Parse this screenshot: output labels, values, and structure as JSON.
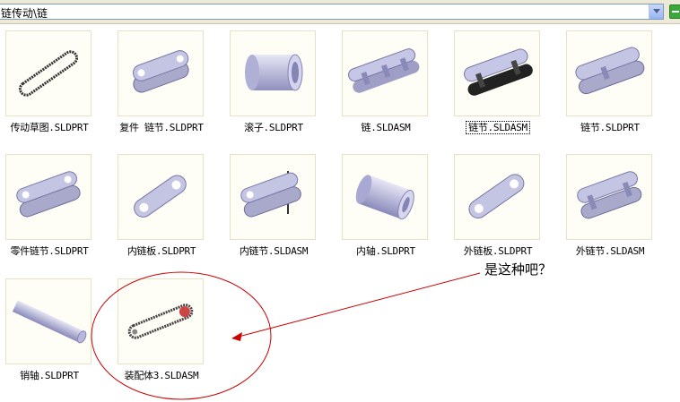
{
  "address_bar": {
    "path": "链传动\\链",
    "go_color": "#3aa83a"
  },
  "files": [
    {
      "name": "传动草图.SLDPRT",
      "icon": "sketch-chain-loop-icon"
    },
    {
      "name": "复件 链节.SLDPRT",
      "icon": "chain-link-icon"
    },
    {
      "name": "滚子.SLDPRT",
      "icon": "roller-cylinder-icon"
    },
    {
      "name": "链.SLDASM",
      "icon": "chain-assembly-icon"
    },
    {
      "name": "链节.SLDASM",
      "icon": "chain-link-assembly-icon",
      "selected": true
    },
    {
      "name": "链节.SLDPRT",
      "icon": "chain-link-icon"
    },
    {
      "name": "零件链节.SLDPRT",
      "icon": "chain-link-icon"
    },
    {
      "name": "内链板.SLDPRT",
      "icon": "inner-plate-icon"
    },
    {
      "name": "内链节.SLDASM",
      "icon": "inner-link-assembly-icon"
    },
    {
      "name": "内轴.SLDPRT",
      "icon": "bushing-cylinder-icon"
    },
    {
      "name": "外链板.SLDPRT",
      "icon": "outer-plate-icon"
    },
    {
      "name": "外链节.SLDASM",
      "icon": "outer-link-assembly-icon"
    },
    {
      "name": "销轴.SLDPRT",
      "icon": "pin-shaft-icon"
    },
    {
      "name": "装配体3.SLDASM",
      "icon": "chain-drive-assembly-icon"
    }
  ],
  "annotation": {
    "text": "是这种吧？",
    "color": "#cc0000"
  }
}
